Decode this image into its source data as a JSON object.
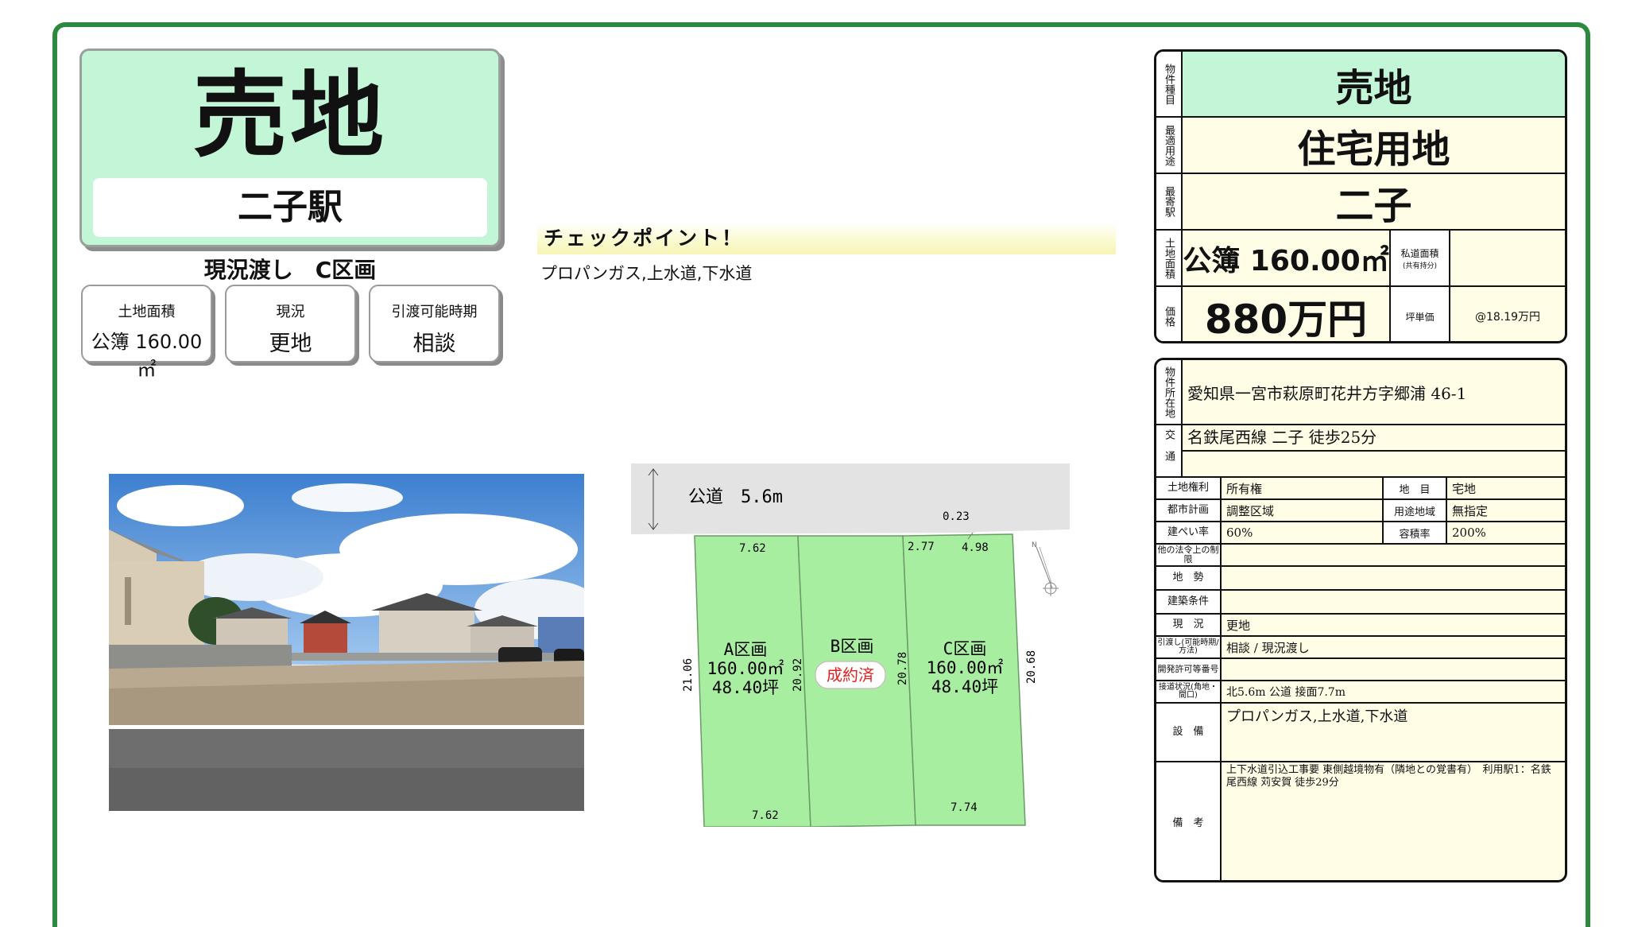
{
  "hero": {
    "title": "売地",
    "station": "二子駅",
    "subtitle": "現況渡し　C区画"
  },
  "stats": [
    {
      "label": "土地面積",
      "value": "公簿 160.00㎡"
    },
    {
      "label": "現況",
      "value": "更地"
    },
    {
      "label": "引渡可能時期",
      "value": "相談"
    }
  ],
  "checkpoint": {
    "title": "チェックポイント！",
    "body": "プロパンガス,上水道,下水道"
  },
  "plot": {
    "road_label": "公道　5.6m",
    "dims": {
      "a_top": "7.62",
      "a_bottom": "7.62",
      "a_left": "21.06",
      "ab_mid": "20.92",
      "bc_mid": "20.78",
      "c_right": "20.68",
      "c_top_left": "2.77",
      "c_top_right": "4.98",
      "c_corner": "0.23",
      "c_bottom": "7.74"
    },
    "lots": [
      {
        "name": "A区画",
        "area": "160.00㎡",
        "tsubo": "48.40坪"
      },
      {
        "name": "B区画",
        "status": "成約済"
      },
      {
        "name": "C区画",
        "area": "160.00㎡",
        "tsubo": "48.40坪"
      }
    ],
    "north": "N",
    "colors": {
      "lot": "#a8eea0",
      "road": "#e3e3e3",
      "sold": "#e02020"
    }
  },
  "summary": {
    "rows": [
      {
        "label": "物件種目",
        "value": "売地"
      },
      {
        "label": "最適用途",
        "value": "住宅用地"
      },
      {
        "label": "最寄駅",
        "value": "二子"
      }
    ],
    "area_label": "土地面積",
    "area_value": "公簿 160.00㎡",
    "private_road_label": "私道面積",
    "private_road_sub": "(共有持分)",
    "private_road_value": "",
    "price_label": "価格",
    "price_value": "880万円",
    "unit_label": "坪単価",
    "unit_value": "@18.19万円"
  },
  "details": {
    "location_label": "物件所在地",
    "location": "愛知県一宮市萩原町花井方字郷浦 46-1",
    "transport_label": "交通",
    "transport": "名鉄尾西線 二子 徒歩25分",
    "rights_label": "土地権利",
    "rights": "所有権",
    "chimoku_label": "地　目",
    "chimoku": "宅地",
    "city_plan_label": "都市計画",
    "city_plan": "調整区域",
    "use_zone_label": "用途地域",
    "use_zone": "無指定",
    "bcr_label": "建ぺい率",
    "bcr": "60%",
    "far_label": "容積率",
    "far": "200%",
    "legal_label": "他の法令上の制限",
    "legal": "",
    "terrain_label": "地　勢",
    "terrain": "",
    "build_cond_label": "建築条件",
    "build_cond": "",
    "status_label": "現　況",
    "status": "更地",
    "handover_label": "引渡し(可能時期/方法)",
    "handover": "相談 / 現況渡し",
    "permit_label": "開発許可等番号",
    "permit": "",
    "access_label": "接道状況(角地・間口)",
    "access": "北5.6m 公道 接面7.7m",
    "facilities_label": "設　備",
    "facilities": "プロパンガス,上水道,下水道",
    "remarks_label": "備　考",
    "remarks": "上下水道引込工事要 東側越境物有（隣地との覚書有）　利用駅1：名鉄尾西線 苅安賀 徒歩29分"
  }
}
